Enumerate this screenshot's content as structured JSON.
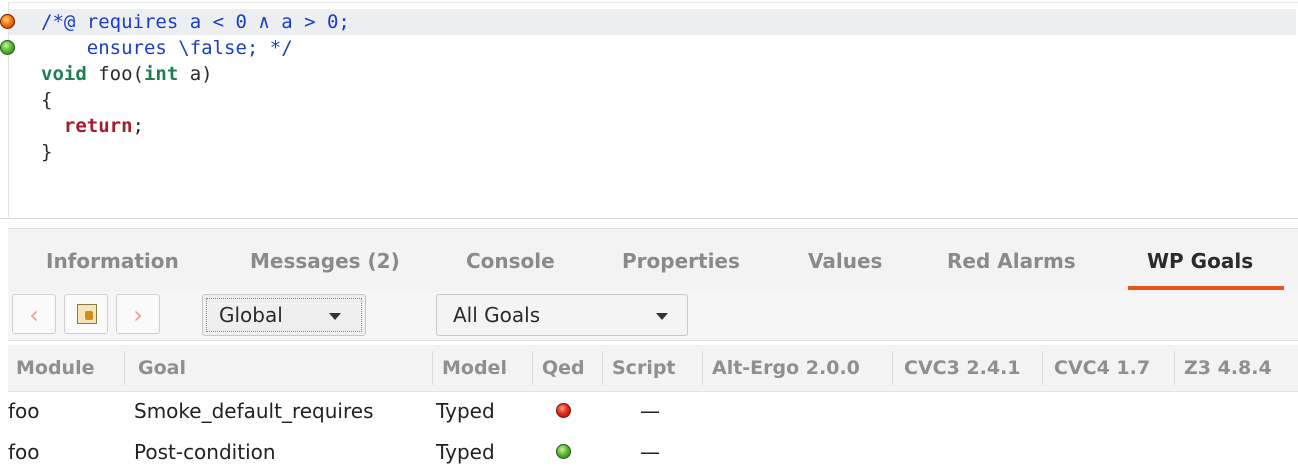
{
  "editor": {
    "lines": [
      {
        "status": "red",
        "parts": [
          {
            "cls": "cmt",
            "text": "/*@ requires a < 0 ∧ a > 0;"
          }
        ]
      },
      {
        "status": "green",
        "parts": [
          {
            "cls": "cmt",
            "text": "    ensures \\false; */"
          }
        ]
      },
      {
        "status": "",
        "parts": [
          {
            "cls": "kw-type",
            "text": "void"
          },
          {
            "cls": "plain",
            "text": " foo("
          },
          {
            "cls": "kw-type",
            "text": "int"
          },
          {
            "cls": "plain",
            "text": " a)"
          }
        ]
      },
      {
        "status": "",
        "parts": [
          {
            "cls": "plain",
            "text": "{"
          }
        ]
      },
      {
        "status": "",
        "parts": [
          {
            "cls": "plain",
            "text": "  "
          },
          {
            "cls": "kw-ret",
            "text": "return"
          },
          {
            "cls": "plain",
            "text": ";"
          }
        ]
      },
      {
        "status": "",
        "parts": [
          {
            "cls": "plain",
            "text": "}"
          }
        ]
      }
    ]
  },
  "tabs": [
    {
      "label": "Information",
      "active": false
    },
    {
      "label": "Messages (2)",
      "active": false
    },
    {
      "label": "Console",
      "active": false
    },
    {
      "label": "Properties",
      "active": false
    },
    {
      "label": "Values",
      "active": false
    },
    {
      "label": "Red Alarms",
      "active": false
    },
    {
      "label": "WP Goals",
      "active": true
    }
  ],
  "toolbar": {
    "prev_icon": "chevron-left-icon",
    "tool_icon": "hand-pointer-icon",
    "next_icon": "chevron-right-icon",
    "scope_select": "Global",
    "goals_select": "All Goals"
  },
  "table": {
    "headers": [
      "Module",
      "Goal",
      "Model",
      "Qed",
      "Script",
      "Alt-Ergo 2.0.0",
      "CVC3 2.4.1",
      "CVC4 1.7",
      "Z3 4.8.4"
    ],
    "rows": [
      {
        "module": "foo",
        "goal": "Smoke_default_requires",
        "model": "Typed",
        "qed": "red",
        "script": "—"
      },
      {
        "module": "foo",
        "goal": "Post-condition",
        "model": "Typed",
        "qed": "green",
        "script": "—"
      }
    ]
  },
  "colors": {
    "accent_underline": "#e9541b",
    "comment": "#1a3fc4",
    "keyword_type": "#1f7f52",
    "keyword_return": "#a41d2e"
  }
}
